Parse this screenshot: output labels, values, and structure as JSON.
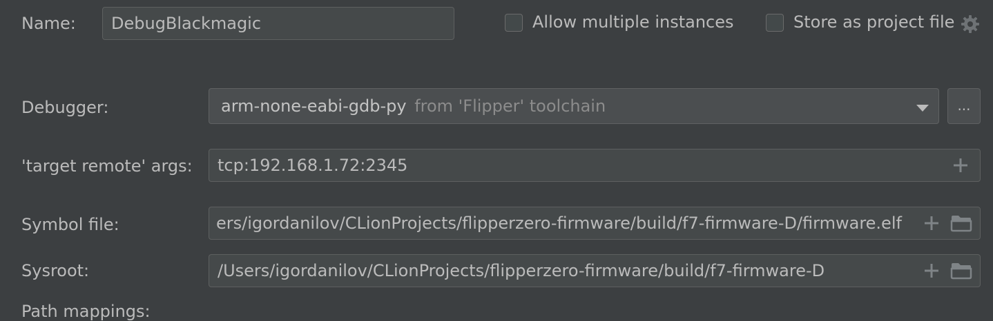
{
  "name": {
    "label": "Name:",
    "value": "DebugBlackmagic"
  },
  "options": {
    "allow_multiple_label": "Allow multiple instances",
    "allow_multiple_checked": false,
    "store_as_project_label": "Store as project file",
    "store_as_project_checked": false,
    "settings_icon": "gear-icon"
  },
  "debugger": {
    "label": "Debugger:",
    "value_main": "arm-none-eabi-gdb-py",
    "value_hint": "from 'Flipper' toolchain",
    "browse_label": "..."
  },
  "target_remote": {
    "label": "'target remote' args:",
    "value": "tcp:192.168.1.72:2345"
  },
  "symbol_file": {
    "label": "Symbol file:",
    "value": "ers/igordanilov/CLionProjects/flipperzero-firmware/build/f7-firmware-D/firmware.elf"
  },
  "sysroot": {
    "label": "Sysroot:",
    "value": "/Users/igordanilov/CLionProjects/flipperzero-firmware/build/f7-firmware-D"
  },
  "path_mappings": {
    "label": "Path mappings:"
  },
  "icons": {
    "plus": "plus-icon",
    "folder": "folder-icon",
    "dropdown": "chevron-down-icon"
  }
}
